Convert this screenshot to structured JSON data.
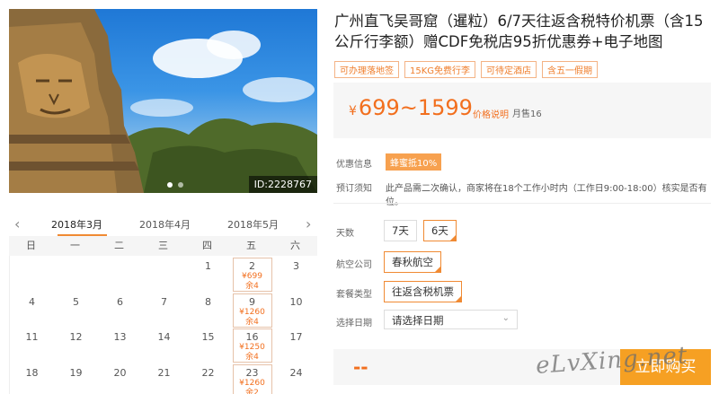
{
  "hero": {
    "image_id": "ID:2228767",
    "carousel_dots": 2
  },
  "product": {
    "title": "广州直飞吴哥窟（暹粒）6/7天往返含税特价机票（含15公斤行李额）赠CDF免税店95折优惠券+电子地图",
    "tags": [
      "可办理落地签",
      "15KG免费行李",
      "可待定酒店",
      "含五一假期"
    ],
    "price_symbol": "¥",
    "price_range": "699~1599",
    "price_note": "价格说明",
    "monthly_sales": "月售16"
  },
  "info": {
    "promo_label": "优惠信息",
    "promo_badge": "蜂蜜抵10%",
    "notice_label": "预订须知",
    "notice_text": "此产品需二次确认，商家将在18个工作小时内（工作日9:00-18:00）核实是否有位。"
  },
  "options": {
    "days_label": "天数",
    "days": [
      "7天",
      "6天"
    ],
    "airline_label": "航空公司",
    "airline": "春秋航空",
    "package_label": "套餐类型",
    "package": "往返含税机票",
    "date_label": "选择日期",
    "date_placeholder": "请选择日期"
  },
  "purchase": {
    "total": "--",
    "buy_label": "立即购买",
    "watermark": "eLvXing.net"
  },
  "calendar": {
    "prev_arrow": "‹",
    "next_arrow": "›",
    "months": [
      "2018年3月",
      "2018年4月",
      "2018年5月"
    ],
    "active_month": 0,
    "weekdays": [
      "日",
      "一",
      "二",
      "三",
      "四",
      "五",
      "六"
    ],
    "rows": [
      [
        null,
        null,
        null,
        null,
        {
          "d": "1"
        },
        {
          "d": "2",
          "price": "¥699",
          "left": "余4"
        },
        {
          "d": "3"
        }
      ],
      [
        {
          "d": "4"
        },
        {
          "d": "5"
        },
        {
          "d": "6"
        },
        {
          "d": "7"
        },
        {
          "d": "8"
        },
        {
          "d": "9",
          "price": "¥1260",
          "left": "余4"
        },
        {
          "d": "10"
        }
      ],
      [
        {
          "d": "11"
        },
        {
          "d": "12"
        },
        {
          "d": "13"
        },
        {
          "d": "14"
        },
        {
          "d": "15"
        },
        {
          "d": "16",
          "price": "¥1250",
          "left": "余4"
        },
        {
          "d": "17"
        }
      ],
      [
        {
          "d": "18"
        },
        {
          "d": "19"
        },
        {
          "d": "20"
        },
        {
          "d": "21"
        },
        {
          "d": "22"
        },
        {
          "d": "23",
          "price": "¥1260",
          "left": "余2"
        },
        {
          "d": "24"
        }
      ]
    ]
  },
  "colors": {
    "accent": "#f26f1e",
    "buy_button": "#f6a023",
    "badge": "#f7a14f"
  }
}
